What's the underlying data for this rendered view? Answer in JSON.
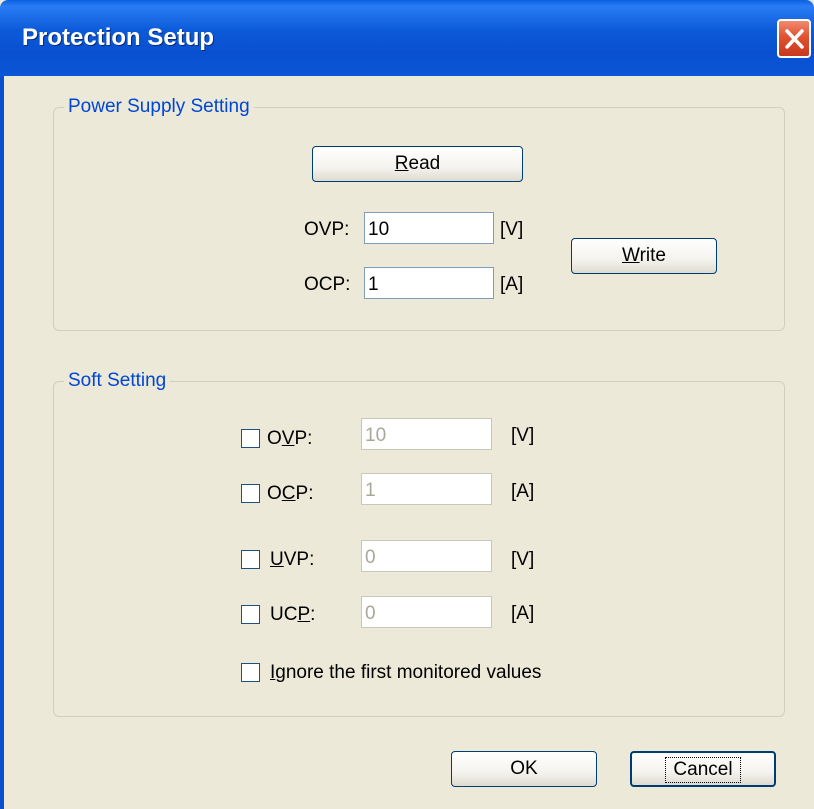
{
  "window": {
    "title": "Protection Setup"
  },
  "power_supply": {
    "group_label": "Power Supply Setting",
    "read_button": {
      "label": "Read",
      "accel": "R"
    },
    "write_button": {
      "label": "Write",
      "accel": "W"
    },
    "ovp": {
      "label": "OVP:",
      "value": "10",
      "unit": "[V]"
    },
    "ocp": {
      "label": "OCP:",
      "value": "1",
      "unit": "[A]"
    }
  },
  "soft": {
    "group_label": "Soft Setting",
    "rows": [
      {
        "label": "OVP:",
        "accel": "V",
        "value": "10",
        "unit": "[V]",
        "checked": false
      },
      {
        "label": "OCP:",
        "accel": "C",
        "value": "1",
        "unit": "[A]",
        "checked": false
      },
      {
        "label": "UVP:",
        "accel": "U",
        "value": "0",
        "unit": "[V]",
        "checked": false
      },
      {
        "label": "UCP:",
        "accel": "P",
        "value": "0",
        "unit": "[A]",
        "checked": false
      }
    ],
    "ignore_first": {
      "label": "Ignore the first monitored values",
      "accel": "I",
      "checked": false
    }
  },
  "footer": {
    "ok_label": "OK",
    "cancel_label": "Cancel"
  },
  "colors": {
    "title_bar": "#0a5fe0",
    "group_label": "#0046d5",
    "dialog_bg": "#ece9d8",
    "close": "#e15230"
  },
  "icons": {
    "close": "close-icon"
  }
}
